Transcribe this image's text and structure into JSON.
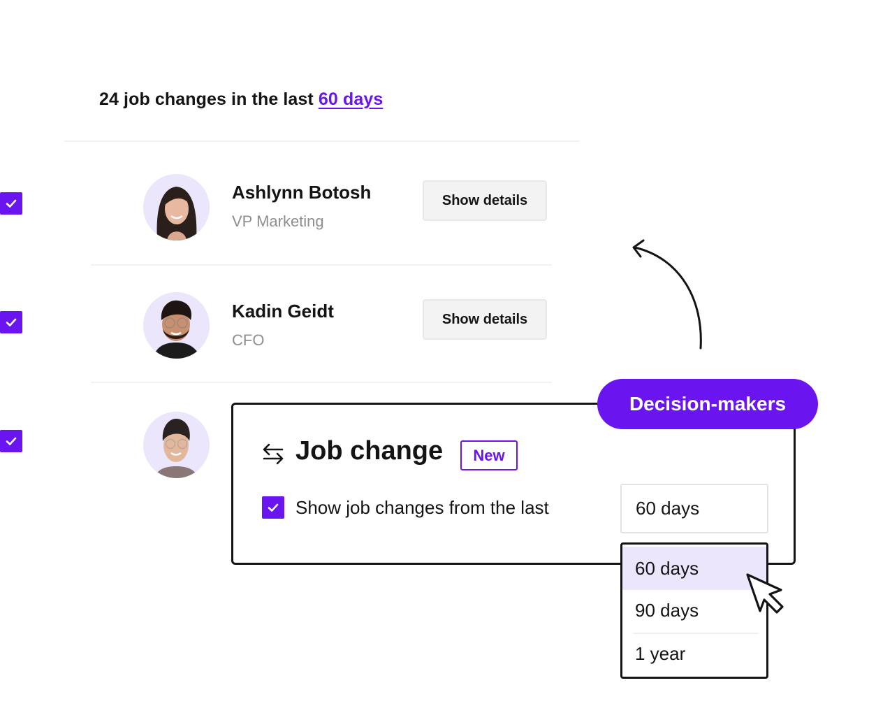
{
  "headline": {
    "prefix": "24 job changes in the last",
    "link": "60 days"
  },
  "people": [
    {
      "name": "Ashlynn Botosh",
      "title": "VP Marketing",
      "checked": true,
      "button": "Show details",
      "avatar": "woman-dark-hair-avatar"
    },
    {
      "name": "Kadin Geidt",
      "title": "CFO",
      "checked": true,
      "button": "Show details",
      "avatar": "man-glasses-beard-avatar"
    },
    {
      "name": "",
      "title": "",
      "checked": true,
      "avatar": "woman-glasses-bun-avatar"
    }
  ],
  "filter_card": {
    "tag": "Decision-makers",
    "title": "Job change",
    "badge": "New",
    "icon": "swap-arrows-icon",
    "checkbox_label": "Show job changes from the last",
    "checked": true,
    "select_value": "60 days",
    "options": [
      "60 days",
      "90 days",
      "1 year"
    ],
    "selected_option": "60 days"
  },
  "colors": {
    "accent": "#6a14f0",
    "accent_light": "#ece6fd",
    "text": "#141414",
    "muted": "#8e8e8e"
  }
}
